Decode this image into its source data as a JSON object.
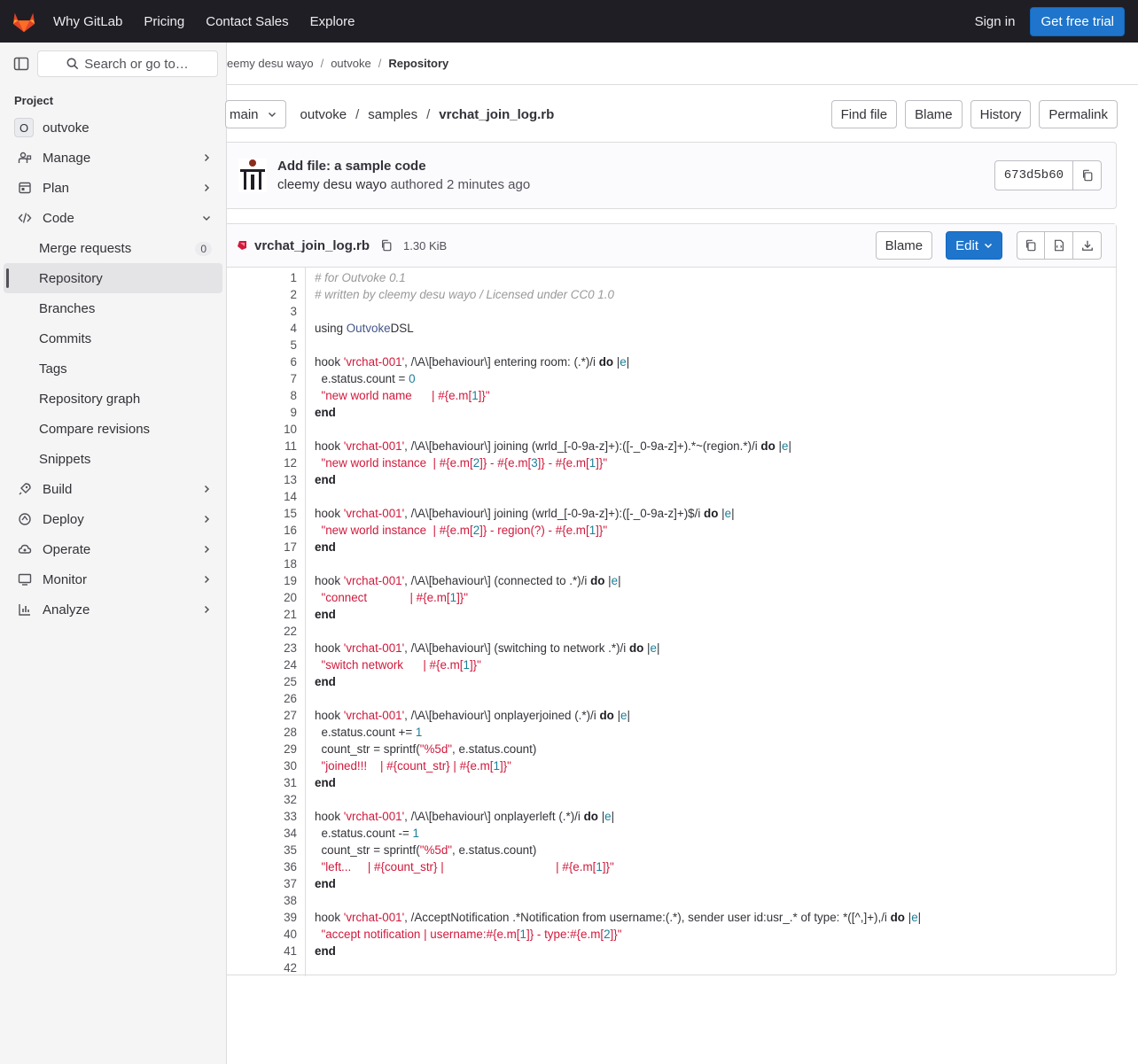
{
  "topbar": {
    "nav": [
      "Why GitLab",
      "Pricing",
      "Contact Sales",
      "Explore"
    ],
    "sign_in": "Sign in",
    "trial": "Get free trial"
  },
  "sidebar": {
    "search_label": "Search or go to…",
    "section_heading": "Project",
    "project_initial": "O",
    "project_name": "outvoke",
    "items": [
      {
        "label": "Manage",
        "icon": "users-icon"
      },
      {
        "label": "Plan",
        "icon": "plan-icon"
      },
      {
        "label": "Code",
        "icon": "code-icon"
      }
    ],
    "code_sub": [
      {
        "label": "Merge requests",
        "badge": "0"
      },
      {
        "label": "Repository"
      },
      {
        "label": "Branches"
      },
      {
        "label": "Commits"
      },
      {
        "label": "Tags"
      },
      {
        "label": "Repository graph"
      },
      {
        "label": "Compare revisions"
      },
      {
        "label": "Snippets"
      }
    ],
    "items_after": [
      {
        "label": "Build",
        "icon": "rocket-icon"
      },
      {
        "label": "Deploy",
        "icon": "deploy-icon"
      },
      {
        "label": "Operate",
        "icon": "cloud-icon"
      },
      {
        "label": "Monitor",
        "icon": "monitor-icon"
      },
      {
        "label": "Analyze",
        "icon": "chart-icon"
      }
    ]
  },
  "breadcrumb": [
    "eemy desu wayo",
    "outvoke",
    "Repository"
  ],
  "filenav": {
    "branch": "main",
    "path": [
      "outvoke",
      "samples",
      "vrchat_join_log.rb"
    ],
    "actions": [
      "Find file",
      "Blame",
      "History",
      "Permalink"
    ]
  },
  "commit": {
    "title": "Add file: a sample code",
    "author": "cleemy desu wayo",
    "meta": "authored 2 minutes ago",
    "sha": "673d5b60"
  },
  "blob": {
    "filename": "vrchat_join_log.rb",
    "size": "1.30 KiB",
    "blame": "Blame",
    "edit": "Edit"
  },
  "code_lines": [
    [
      [
        "c",
        "# for Outvoke 0.1"
      ]
    ],
    [
      [
        "c",
        "# written by cleemy desu wayo / Licensed under CC0 1.0"
      ]
    ],
    [],
    [
      [
        "p",
        "using "
      ],
      [
        "t",
        "Outvoke"
      ],
      [
        "p",
        "DSL"
      ]
    ],
    [],
    [
      [
        "p",
        "hook "
      ],
      [
        "s",
        "'vrchat-001'"
      ],
      [
        "p",
        ", /\\A\\[behaviour\\] entering room: (.*)/i "
      ],
      [
        "k",
        "do"
      ],
      [
        "p",
        " |"
      ],
      [
        "n",
        "e"
      ],
      [
        "p",
        "|"
      ]
    ],
    [
      [
        "p",
        "  e.status.count = "
      ],
      [
        "n",
        "0"
      ]
    ],
    [
      [
        "s",
        "  \"new world name      | #{e.m["
      ],
      [
        "n",
        "1"
      ],
      [
        "s",
        "]}\""
      ]
    ],
    [
      [
        "k",
        "end"
      ]
    ],
    [],
    [
      [
        "p",
        "hook "
      ],
      [
        "s",
        "'vrchat-001'"
      ],
      [
        "p",
        ", /\\A\\[behaviour\\] joining (wrld_[-0-9a-z]+):([-_0-9a-z]+).*~(region.*)/i "
      ],
      [
        "k",
        "do"
      ],
      [
        "p",
        " |"
      ],
      [
        "n",
        "e"
      ],
      [
        "p",
        "|"
      ]
    ],
    [
      [
        "s",
        "  \"new world instance  | #{e.m["
      ],
      [
        "n",
        "2"
      ],
      [
        "s",
        "]} - #{e.m["
      ],
      [
        "n",
        "3"
      ],
      [
        "s",
        "]} - #{e.m["
      ],
      [
        "n",
        "1"
      ],
      [
        "s",
        "]}\""
      ]
    ],
    [
      [
        "k",
        "end"
      ]
    ],
    [],
    [
      [
        "p",
        "hook "
      ],
      [
        "s",
        "'vrchat-001'"
      ],
      [
        "p",
        ", /\\A\\[behaviour\\] joining (wrld_[-0-9a-z]+):([-_0-9a-z]+)$/i "
      ],
      [
        "k",
        "do"
      ],
      [
        "p",
        " |"
      ],
      [
        "n",
        "e"
      ],
      [
        "p",
        "|"
      ]
    ],
    [
      [
        "s",
        "  \"new world instance  | #{e.m["
      ],
      [
        "n",
        "2"
      ],
      [
        "s",
        "]} - region(?) - #{e.m["
      ],
      [
        "n",
        "1"
      ],
      [
        "s",
        "]}\""
      ]
    ],
    [
      [
        "k",
        "end"
      ]
    ],
    [],
    [
      [
        "p",
        "hook "
      ],
      [
        "s",
        "'vrchat-001'"
      ],
      [
        "p",
        ", /\\A\\[behaviour\\] (connected to .*)/i "
      ],
      [
        "k",
        "do"
      ],
      [
        "p",
        " |"
      ],
      [
        "n",
        "e"
      ],
      [
        "p",
        "|"
      ]
    ],
    [
      [
        "s",
        "  \"connect             | #{e.m["
      ],
      [
        "n",
        "1"
      ],
      [
        "s",
        "]}\""
      ]
    ],
    [
      [
        "k",
        "end"
      ]
    ],
    [],
    [
      [
        "p",
        "hook "
      ],
      [
        "s",
        "'vrchat-001'"
      ],
      [
        "p",
        ", /\\A\\[behaviour\\] (switching to network .*)/i "
      ],
      [
        "k",
        "do"
      ],
      [
        "p",
        " |"
      ],
      [
        "n",
        "e"
      ],
      [
        "p",
        "|"
      ]
    ],
    [
      [
        "s",
        "  \"switch network      | #{e.m["
      ],
      [
        "n",
        "1"
      ],
      [
        "s",
        "]}\""
      ]
    ],
    [
      [
        "k",
        "end"
      ]
    ],
    [],
    [
      [
        "p",
        "hook "
      ],
      [
        "s",
        "'vrchat-001'"
      ],
      [
        "p",
        ", /\\A\\[behaviour\\] onplayerjoined (.*)/i "
      ],
      [
        "k",
        "do"
      ],
      [
        "p",
        " |"
      ],
      [
        "n",
        "e"
      ],
      [
        "p",
        "|"
      ]
    ],
    [
      [
        "p",
        "  e.status.count += "
      ],
      [
        "n",
        "1"
      ]
    ],
    [
      [
        "p",
        "  count_str = sprintf("
      ],
      [
        "s",
        "\"%5d\""
      ],
      [
        "p",
        ", e.status.count)"
      ]
    ],
    [
      [
        "s",
        "  \"joined!!!    | #{count_str} | #{e.m["
      ],
      [
        "n",
        "1"
      ],
      [
        "s",
        "]}\""
      ]
    ],
    [
      [
        "k",
        "end"
      ]
    ],
    [],
    [
      [
        "p",
        "hook "
      ],
      [
        "s",
        "'vrchat-001'"
      ],
      [
        "p",
        ", /\\A\\[behaviour\\] onplayerleft (.*)/i "
      ],
      [
        "k",
        "do"
      ],
      [
        "p",
        " |"
      ],
      [
        "n",
        "e"
      ],
      [
        "p",
        "|"
      ]
    ],
    [
      [
        "p",
        "  e.status.count -= "
      ],
      [
        "n",
        "1"
      ]
    ],
    [
      [
        "p",
        "  count_str = sprintf("
      ],
      [
        "s",
        "\"%5d\""
      ],
      [
        "p",
        ", e.status.count)"
      ]
    ],
    [
      [
        "s",
        "  \"left...     | #{count_str} |                                  | #{e.m["
      ],
      [
        "n",
        "1"
      ],
      [
        "s",
        "]}\""
      ]
    ],
    [
      [
        "k",
        "end"
      ]
    ],
    [],
    [
      [
        "p",
        "hook "
      ],
      [
        "s",
        "'vrchat-001'"
      ],
      [
        "p",
        ", /AcceptNotification .*Notification from username:(.*), sender user id:usr_.* of type: *([^,]+),/i "
      ],
      [
        "k",
        "do"
      ],
      [
        "p",
        " |"
      ],
      [
        "n",
        "e"
      ],
      [
        "p",
        "|"
      ]
    ],
    [
      [
        "s",
        "  \"accept notification | username:#{e.m["
      ],
      [
        "n",
        "1"
      ],
      [
        "s",
        "]} - type:#{e.m["
      ],
      [
        "n",
        "2"
      ],
      [
        "s",
        "]}\""
      ]
    ],
    [
      [
        "k",
        "end"
      ]
    ],
    []
  ]
}
